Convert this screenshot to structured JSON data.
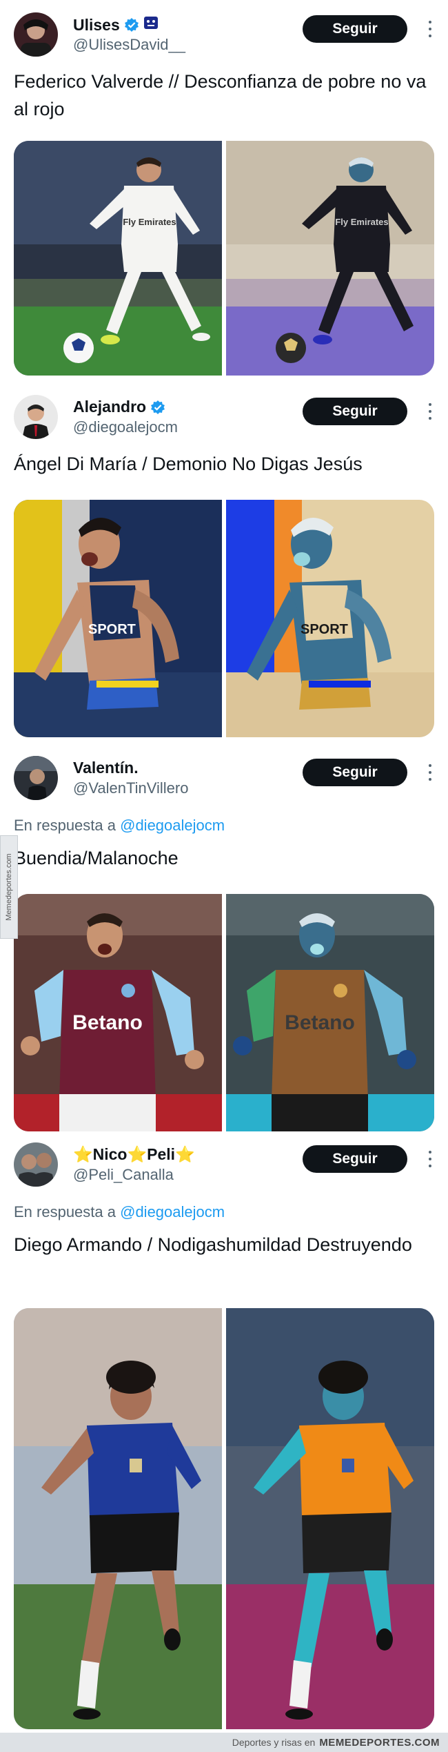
{
  "tweets": [
    {
      "name": "Ulises",
      "handle": "@UlisesDavid__",
      "follow_label": "Seguir",
      "text": "Federico Valverde // Desconfianza de pobre no va al rojo",
      "media": [
        "photo-original",
        "photo-inverted"
      ]
    },
    {
      "name": "Alejandro",
      "handle": "@diegoalejocm",
      "follow_label": "Seguir",
      "text": "Ángel Di María / Demonio No Digas Jesús",
      "media": [
        "photo-original",
        "photo-inverted"
      ]
    },
    {
      "name": "Valentín.",
      "handle": "@ValenTinVillero",
      "follow_label": "Seguir",
      "reply_prefix": "En respuesta a",
      "reply_to": "@diegoalejocm",
      "text": "Buendia/Malanoche",
      "media": [
        "photo-original",
        "photo-inverted"
      ]
    },
    {
      "name": "⭐Nico⭐Peli⭐",
      "handle": "@Peli_Canalla",
      "follow_label": "Seguir",
      "reply_prefix": "En respuesta a",
      "reply_to": "@diegoalejocm",
      "text": "Diego Armando / Nodigashumildad Destruyendo",
      "media": [
        "photo-original",
        "photo-inverted"
      ]
    }
  ],
  "shirt_text": {
    "valverde": "Fly Emirates",
    "dimaria": "SPORT",
    "buendia": "Betano"
  },
  "watermark": {
    "side": "Memedeportes.com",
    "footer_prefix": "Deportes y risas en",
    "footer_brand": "MEMEDEPORTES.COM"
  },
  "colors": {
    "accent": "#1d9bf0",
    "follow_bg": "#0f1419",
    "muted": "#536471"
  },
  "icons": [
    "verified-badge-icon",
    "more-options-icon"
  ]
}
